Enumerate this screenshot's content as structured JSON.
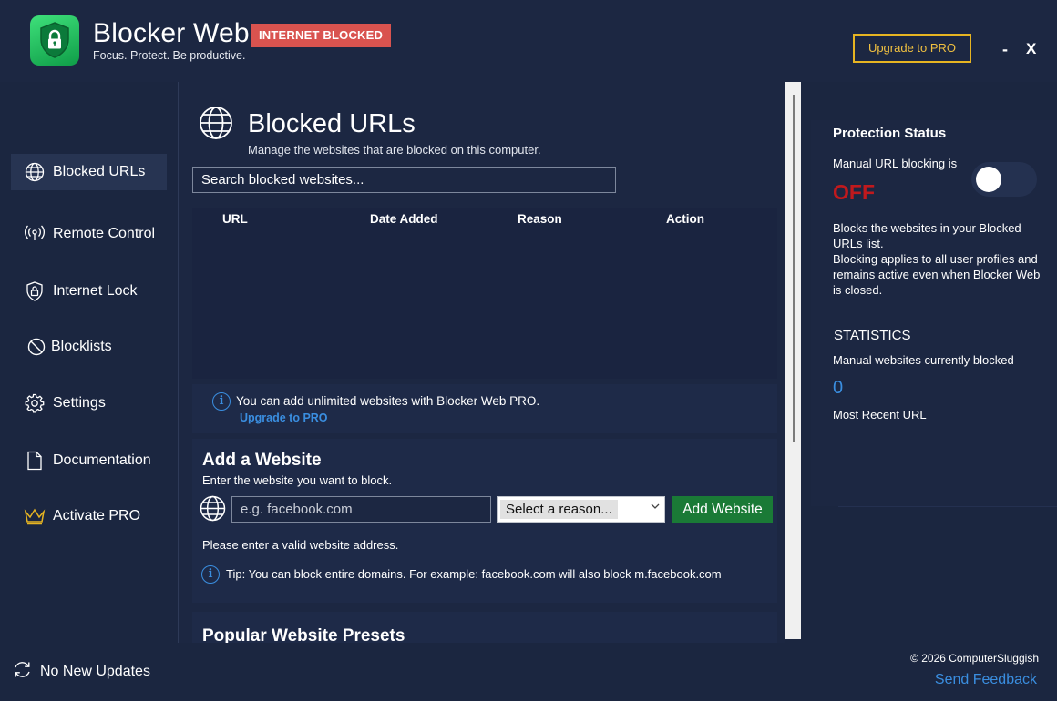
{
  "header": {
    "app_title": "Blocker Web",
    "app_subtitle": "Focus. Protect. Be productive.",
    "status_badge": "INTERNET BLOCKED",
    "upgrade_label": "Upgrade to PRO",
    "minimize_label": "-",
    "close_label": "X"
  },
  "sidebar": {
    "items": [
      {
        "label": "Blocked URLs",
        "icon": "globe-icon",
        "active": true
      },
      {
        "label": "Remote Control",
        "icon": "broadcast-icon"
      },
      {
        "label": "Internet Lock",
        "icon": "shield-lock-icon"
      },
      {
        "label": "Blocklists",
        "icon": "block-icon"
      },
      {
        "label": "Settings",
        "icon": "gear-icon"
      },
      {
        "label": "Documentation",
        "icon": "document-icon"
      },
      {
        "label": "Activate PRO",
        "icon": "crown-icon"
      }
    ]
  },
  "main": {
    "title": "Blocked URLs",
    "subtitle": "Manage the websites that are blocked on this computer.",
    "search_placeholder": "Search blocked websites...",
    "table": {
      "columns": [
        "URL",
        "Date Added",
        "Reason",
        "Action"
      ],
      "rows": []
    },
    "info": {
      "text": "You can add unlimited websites with Blocker Web PRO.",
      "link": "Upgrade to PRO"
    },
    "add_website": {
      "title": "Add a Website",
      "subtitle": "Enter the website you want to block.",
      "input_placeholder": "e.g. facebook.com",
      "reason_selected": "Select a reason...",
      "button_label": "Add Website",
      "validation": "Please enter a valid website address.",
      "tip": "Tip: You can block entire domains. For example: facebook.com will also block m.facebook.com"
    },
    "presets": {
      "title": "Popular Website Presets"
    }
  },
  "protection": {
    "title": "Protection Status",
    "manual_label": "Manual URL blocking is",
    "state": "OFF",
    "toggle_on": false,
    "description": "Blocks the websites in your Blocked URLs list.\nBlocking applies to all user profiles and remains active even when Blocker Web is closed.",
    "stats_title": "STATISTICS",
    "stat_label": "Manual websites currently blocked",
    "stat_value": "0",
    "recent_label": "Most Recent URL"
  },
  "footer": {
    "updates": "No New Updates",
    "copyright": "© 2026 ComputerSluggish",
    "feedback": "Send Feedback"
  },
  "colors": {
    "background": "#1b2640",
    "badge": "#d9534f",
    "accent_gold": "#e6b422",
    "link_blue": "#3a8ee0",
    "status_red": "#c0191d",
    "add_button_green": "#1a7a36"
  }
}
